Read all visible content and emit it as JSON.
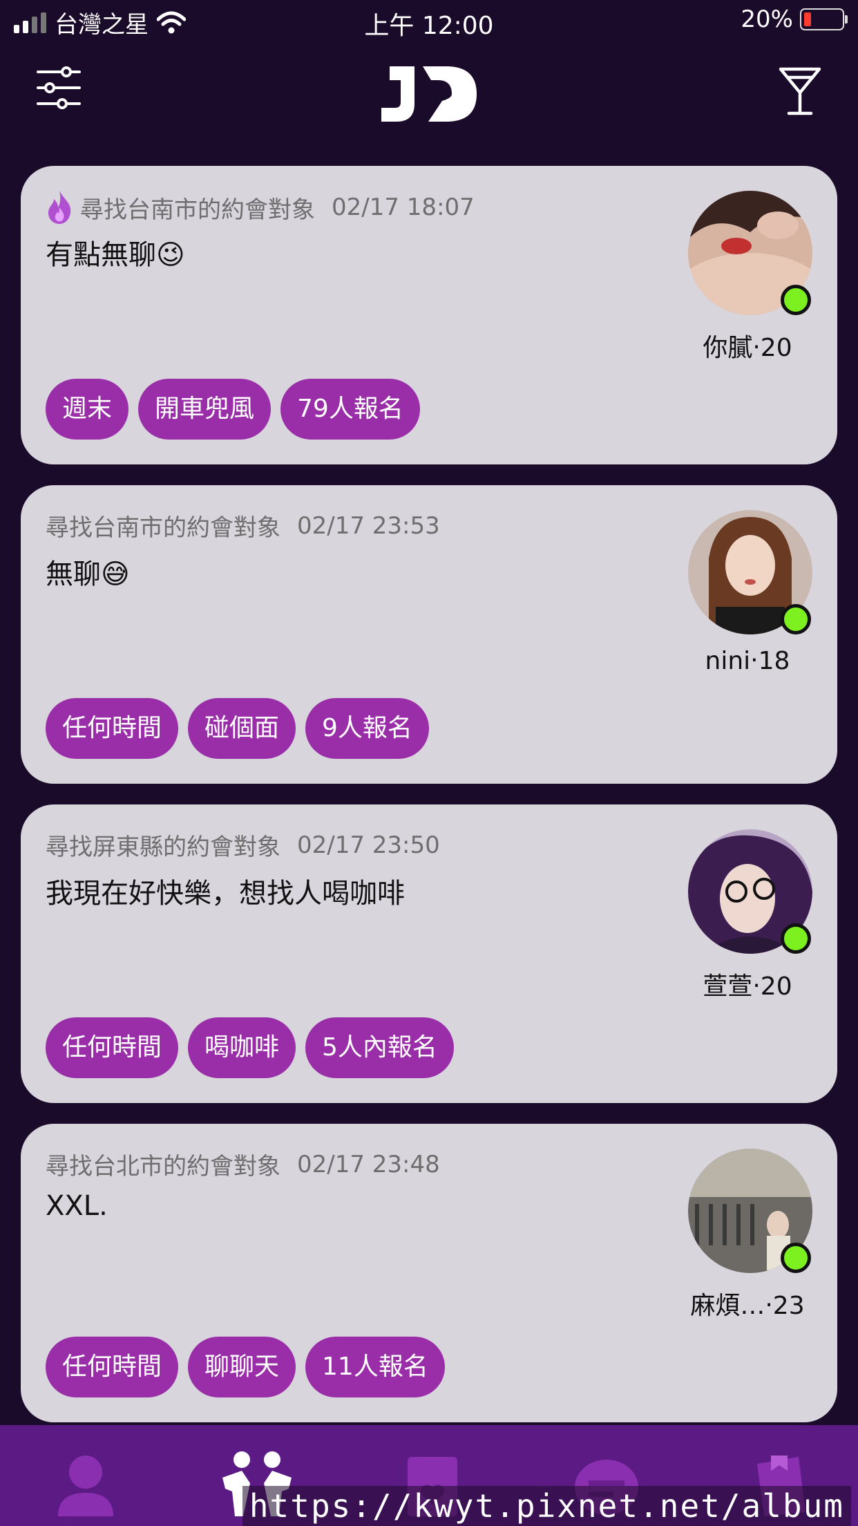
{
  "status_bar": {
    "carrier": "台灣之星",
    "time": "上午 12:00",
    "battery": "20%"
  },
  "header": {
    "logo_alt": "JD"
  },
  "cards": [
    {
      "location_label": "尋找台南市的約會對象",
      "time": "02/17 18:07",
      "message": "有點無聊😉",
      "username": "你膩‧20",
      "tags": [
        "週末",
        "開車兜風",
        "79人報名"
      ],
      "hot": true
    },
    {
      "location_label": "尋找台南市的約會對象",
      "time": "02/17 23:53",
      "message": "無聊😅",
      "username": "nini‧18",
      "tags": [
        "任何時間",
        "碰個面",
        "9人報名"
      ],
      "hot": false
    },
    {
      "location_label": "尋找屏東縣的約會對象",
      "time": "02/17 23:50",
      "message": "我現在好快樂，想找人喝咖啡",
      "username": "萱萱‧20",
      "tags": [
        "任何時間",
        "喝咖啡",
        "5人內報名"
      ],
      "hot": false
    },
    {
      "location_label": "尋找台北市的約會對象",
      "time": "02/17 23:48",
      "message": "XXL.",
      "username": "麻煩…‧23",
      "tags": [
        "任何時間",
        "聊聊天",
        "11人報名"
      ],
      "hot": false
    }
  ],
  "nav": {
    "tabs": [
      "profile-icon",
      "dating-icon",
      "likes-icon",
      "chat-icon",
      "bookmark-icon"
    ]
  },
  "watermark": "https://kwyt.pixnet.net/album",
  "colors": {
    "background": "#1b0b2a",
    "card": "#d9d5dd",
    "tag": "#9a2ea8",
    "online": "#7cf11f",
    "tabbar": "#5c1a84"
  }
}
